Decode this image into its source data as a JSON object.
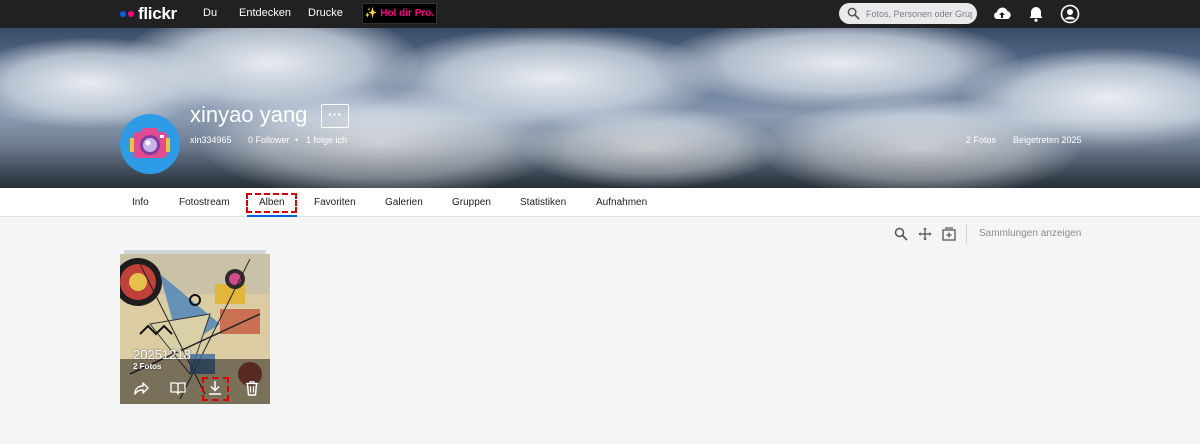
{
  "app": {
    "logo_text": "flickr",
    "brand_colors": {
      "blue": "#0063dc",
      "pink": "#ff0084"
    }
  },
  "topnav": {
    "links": [
      "Du",
      "Entdecken",
      "Drucke"
    ],
    "pro_button": "Hol dir Pro.",
    "search_placeholder": "Fotos, Personen oder Gruppen",
    "icons": [
      "upload-cloud-icon",
      "bell-icon",
      "user-account-icon"
    ]
  },
  "profile": {
    "name": "xinyao yang",
    "more_button": "···",
    "handle": "xin334965",
    "followers": "0 Follower",
    "separator": "•",
    "following": "1 folge ich",
    "photo_count": "2 Fotos",
    "joined": "Beigetreten 2025"
  },
  "tabs": {
    "items": [
      "Info",
      "Fotostream",
      "Alben",
      "Favoriten",
      "Galerien",
      "Gruppen",
      "Statistiken",
      "Aufnahmen"
    ],
    "active": "Alben"
  },
  "toolbar": {
    "icons": [
      "search-icon",
      "arrange-icon",
      "create-album-icon"
    ],
    "collections_link": "Sammlungen anzeigen"
  },
  "albums": [
    {
      "title": "20251218",
      "count": "2 Fotos",
      "actions": [
        "share-icon",
        "book-icon",
        "download-icon",
        "trash-icon"
      ]
    }
  ],
  "annotations": {
    "highlight_color": "#e00000"
  }
}
